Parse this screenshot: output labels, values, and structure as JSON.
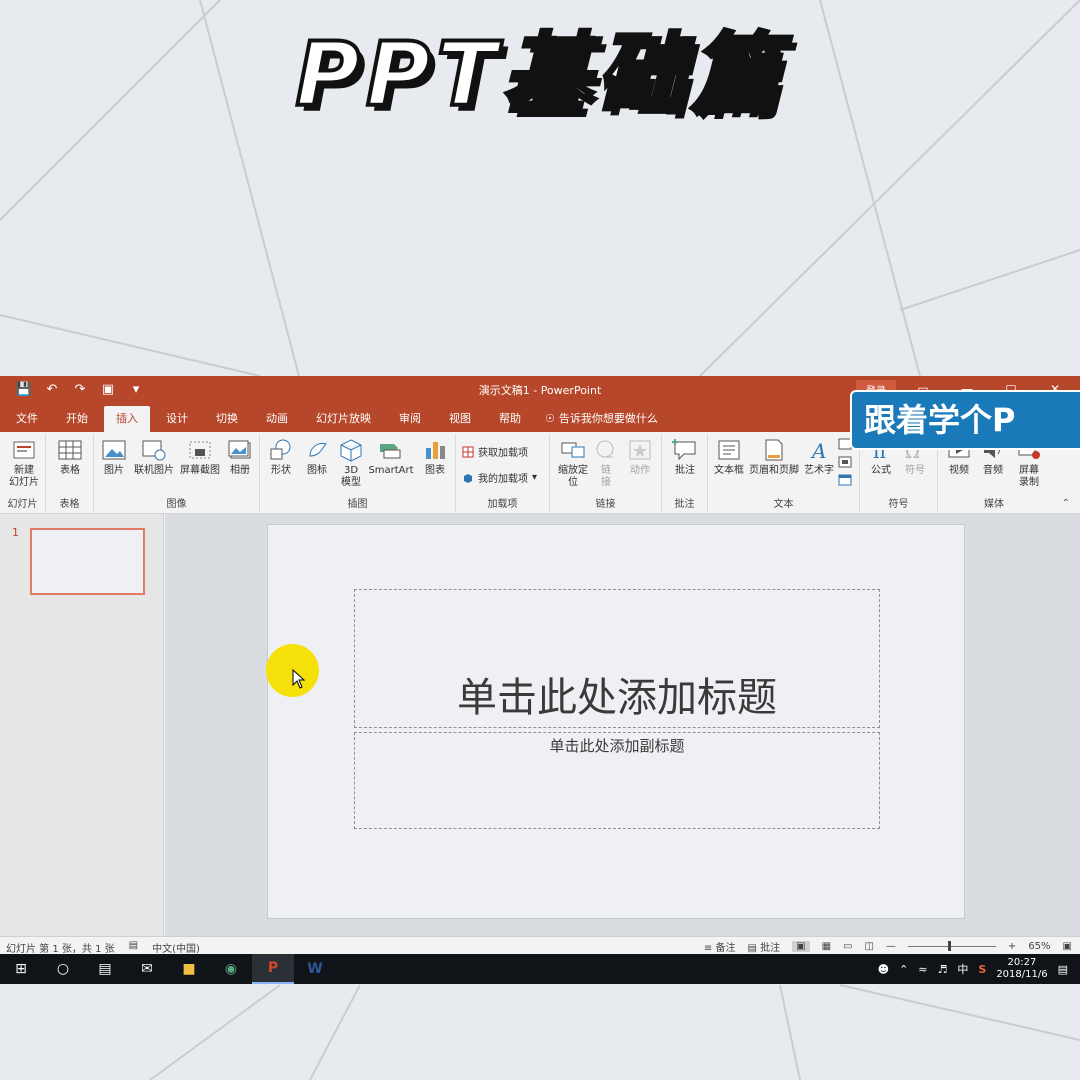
{
  "headline": "PPT基础篇",
  "brand_badge": "跟着学个P",
  "window": {
    "title": "演示文稿1  -  PowerPoint",
    "login": "登录"
  },
  "tabs": [
    {
      "label": "文件"
    },
    {
      "label": "开始"
    },
    {
      "label": "插入",
      "active": true
    },
    {
      "label": "设计"
    },
    {
      "label": "切换"
    },
    {
      "label": "动画"
    },
    {
      "label": "幻灯片放映"
    },
    {
      "label": "审阅"
    },
    {
      "label": "视图"
    },
    {
      "label": "帮助"
    }
  ],
  "tell_me": "告诉我你想要做什么",
  "ribbon": {
    "slides": {
      "label": "幻灯片",
      "new_slide": "新建\n幻灯片"
    },
    "tables": {
      "label": "表格",
      "table": "表格"
    },
    "images": {
      "label": "图像",
      "picture": "图片",
      "online_picture": "联机图片",
      "screenshot": "屏幕截图",
      "album": "相册"
    },
    "illustrations": {
      "label": "插图",
      "shapes": "形状",
      "icons": "图标",
      "model3d": "3D\n模型",
      "smartart": "SmartArt",
      "chart": "图表"
    },
    "addins": {
      "label": "加载项",
      "get_addins": "获取加载项",
      "my_addins": "我的加载项"
    },
    "links": {
      "label": "链接",
      "zoom": "缩放定\n位",
      "link": "链\n接",
      "action": "动作"
    },
    "comments": {
      "label": "批注",
      "comment": "批注"
    },
    "text": {
      "label": "文本",
      "textbox": "文本框",
      "header_footer": "页眉和页脚",
      "wordart": "艺术字"
    },
    "symbols": {
      "label": "符号",
      "equation": "公式",
      "symbol": "符号"
    },
    "media": {
      "label": "媒体",
      "video": "视频",
      "audio": "音频",
      "screen_recording": "屏幕\n录制"
    }
  },
  "slide_panel": {
    "number": "1"
  },
  "slide": {
    "title_placeholder": "单击此处添加标题",
    "subtitle_placeholder": "单击此处添加副标题"
  },
  "statusbar": {
    "slide_info": "幻灯片 第 1 张，共 1 张",
    "language": "中文(中国)",
    "notes": "备注",
    "comments": "批注",
    "zoom": "65%"
  },
  "taskbar": {
    "ime": "中",
    "time": "20:27",
    "date": "2018/11/6"
  },
  "colors": {
    "accent": "#b7472a",
    "badge": "#1a79b8",
    "cursor_highlight": "#f5e00a"
  }
}
